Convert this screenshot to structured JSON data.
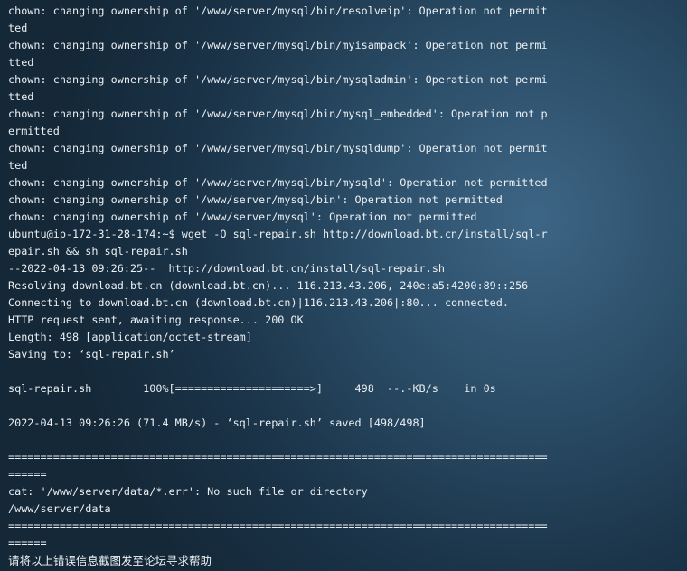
{
  "terminal": {
    "lines": [
      "chown: changing ownership of '/www/server/mysql/bin/resolveip': Operation not permit",
      "ted",
      "chown: changing ownership of '/www/server/mysql/bin/myisampack': Operation not permi",
      "tted",
      "chown: changing ownership of '/www/server/mysql/bin/mysqladmin': Operation not permi",
      "tted",
      "chown: changing ownership of '/www/server/mysql/bin/mysql_embedded': Operation not p",
      "ermitted",
      "chown: changing ownership of '/www/server/mysql/bin/mysqldump': Operation not permit",
      "ted",
      "chown: changing ownership of '/www/server/mysql/bin/mysqld': Operation not permitted",
      "chown: changing ownership of '/www/server/mysql/bin': Operation not permitted",
      "chown: changing ownership of '/www/server/mysql': Operation not permitted",
      "ubuntu@ip-172-31-28-174:~$ wget -O sql-repair.sh http://download.bt.cn/install/sql-r",
      "epair.sh && sh sql-repair.sh",
      "--2022-04-13 09:26:25--  http://download.bt.cn/install/sql-repair.sh",
      "Resolving download.bt.cn (download.bt.cn)... 116.213.43.206, 240e:a5:4200:89::256",
      "Connecting to download.bt.cn (download.bt.cn)|116.213.43.206|:80... connected.",
      "HTTP request sent, awaiting response... 200 OK",
      "Length: 498 [application/octet-stream]",
      "Saving to: ‘sql-repair.sh’",
      "",
      "sql-repair.sh        100%[=====================>]     498  --.-KB/s    in 0s",
      "",
      "2022-04-13 09:26:26 (71.4 MB/s) - ‘sql-repair.sh’ saved [498/498]",
      "",
      "====================================================================================",
      "======",
      "cat: '/www/server/data/*.err': No such file or directory",
      "/www/server/data",
      "====================================================================================",
      "======",
      "请将以上错误信息截图发至论坛寻求帮助"
    ]
  }
}
